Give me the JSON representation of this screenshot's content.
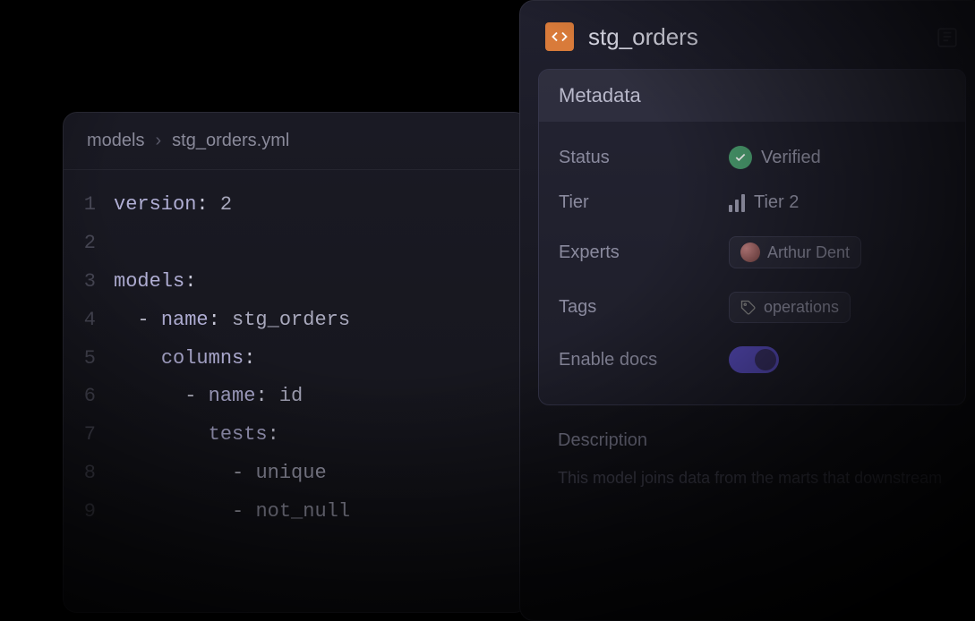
{
  "editor": {
    "breadcrumb": {
      "root": "models",
      "file": "stg_orders.yml"
    },
    "lines": [
      {
        "n": "1",
        "indent": "",
        "key": "version",
        "colon": ": ",
        "val": "2"
      },
      {
        "n": "2",
        "indent": "",
        "key": "",
        "colon": "",
        "val": ""
      },
      {
        "n": "3",
        "indent": "",
        "key": "models",
        "colon": ":",
        "val": ""
      },
      {
        "n": "4",
        "indent": "  - ",
        "key": "name",
        "colon": ": ",
        "val": "stg_orders"
      },
      {
        "n": "5",
        "indent": "    ",
        "key": "columns",
        "colon": ":",
        "val": ""
      },
      {
        "n": "6",
        "indent": "      - ",
        "key": "name",
        "colon": ": ",
        "val": "id"
      },
      {
        "n": "7",
        "indent": "        ",
        "key": "tests",
        "colon": ":",
        "val": ""
      },
      {
        "n": "8",
        "indent": "          - ",
        "key": "",
        "colon": "",
        "val": "unique"
      },
      {
        "n": "9",
        "indent": "          - ",
        "key": "",
        "colon": "",
        "val": "not_null"
      }
    ]
  },
  "meta": {
    "title": "stg_orders",
    "card_title": "Metadata",
    "rows": {
      "status": {
        "label": "Status",
        "value": "Verified"
      },
      "tier": {
        "label": "Tier",
        "value": "Tier 2"
      },
      "experts": {
        "label": "Experts",
        "value": "Arthur Dent"
      },
      "tags": {
        "label": "Tags",
        "value": "operations"
      },
      "enable_docs": {
        "label": "Enable docs"
      }
    },
    "description": {
      "heading": "Description",
      "text": "This model joins data from the marts that downstream"
    }
  }
}
